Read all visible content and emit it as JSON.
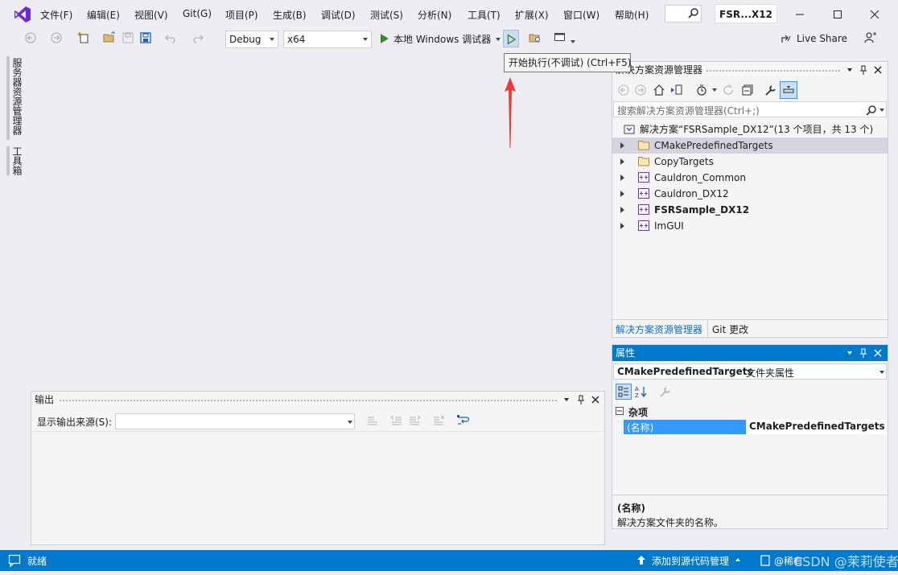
{
  "menu": [
    "文件(F)",
    "编辑(E)",
    "视图(V)",
    "Git(G)",
    "项目(P)",
    "生成(B)",
    "调试(D)",
    "测试(S)",
    "分析(N)",
    "工具(T)",
    "扩展(X)",
    "窗口(W)",
    "帮助(H)"
  ],
  "title": {
    "solution_short": "FSR...X12"
  },
  "toolbar": {
    "config": "Debug",
    "platform": "x64",
    "run_label": "本地 Windows 调试器",
    "live_share": "Live Share",
    "tooltip": "开始执行(不调试) (Ctrl+F5)"
  },
  "left_tabs": [
    "服务器资源管理器",
    "工具箱"
  ],
  "solution_explorer": {
    "title": "解决方案资源管理器",
    "search_placeholder": "搜索解决方案资源管理器(Ctrl+;)",
    "solution_line": "解决方案“FSRSample_DX12”(13 个项目，共 13 个)",
    "items": [
      {
        "label": "CMakePredefinedTargets",
        "icon": "folder-icon",
        "bold": false,
        "selected": true
      },
      {
        "label": "CopyTargets",
        "icon": "folder-icon",
        "bold": false,
        "selected": false
      },
      {
        "label": "Cauldron_Common",
        "icon": "cpp-project-icon",
        "bold": false,
        "selected": false
      },
      {
        "label": "Cauldron_DX12",
        "icon": "cpp-project-icon",
        "bold": false,
        "selected": false
      },
      {
        "label": "FSRSample_DX12",
        "icon": "cpp-project-icon",
        "bold": true,
        "selected": false
      },
      {
        "label": "ImGUI",
        "icon": "cpp-project-icon",
        "bold": false,
        "selected": false
      }
    ],
    "tab_active": "解决方案资源管理器",
    "tab_other": "Git 更改"
  },
  "properties": {
    "title": "属性",
    "object_name": "CMakePredefinedTargets",
    "object_type": "文件夹属性",
    "category": "杂项",
    "prop_name": "(名称)",
    "prop_value": "CMakePredefinedTargets",
    "desc_title": "(名称)",
    "desc_text": "解决方案文件夹的名称。"
  },
  "output": {
    "title": "输出",
    "source_label": "显示输出来源(S):",
    "source_value": ""
  },
  "status": {
    "ready": "就绪",
    "add_source": "添加到源代码管理",
    "repo": "@稀有",
    "watermark": "CSDN @茉莉使者"
  },
  "colors": {
    "accent": "#007acc",
    "selection": "#cce8ff",
    "prop_selected": "#3399ff"
  }
}
